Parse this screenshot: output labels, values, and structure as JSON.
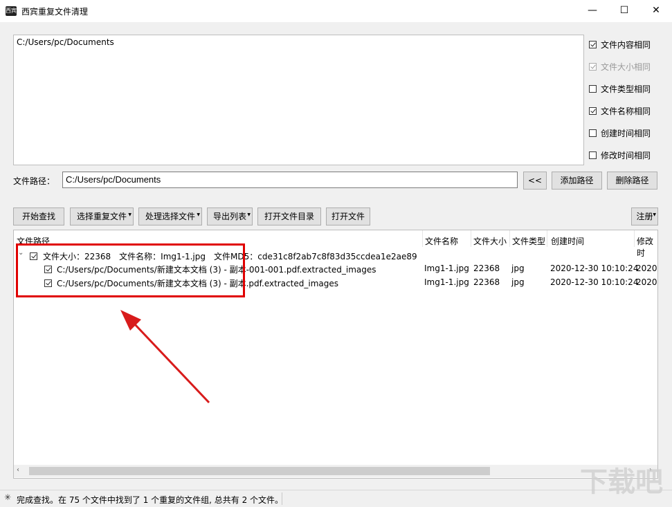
{
  "window": {
    "title": "西宾重复文件清理",
    "icon_text": "西宾",
    "controls": {
      "minimize": "—",
      "maximize": "☐",
      "close": "✕"
    }
  },
  "paths_list": [
    "C:/Users/pc/Documents"
  ],
  "options": [
    {
      "label": "文件内容相同",
      "checked": true,
      "disabled": false
    },
    {
      "label": "文件大小相同",
      "checked": true,
      "disabled": true
    },
    {
      "label": "文件类型相同",
      "checked": false,
      "disabled": false
    },
    {
      "label": "文件名称相同",
      "checked": true,
      "disabled": false
    },
    {
      "label": "创建时间相同",
      "checked": false,
      "disabled": false
    },
    {
      "label": "修改时间相同",
      "checked": false,
      "disabled": false
    }
  ],
  "path_row": {
    "label": "文件路径：",
    "value": "C:/Users/pc/Documents",
    "browse_label": "<<",
    "add_label": "添加路径",
    "remove_label": "删除路径"
  },
  "toolbar": {
    "start": "开始查找",
    "select_dup": "选择重复文件",
    "process": "处理选择文件",
    "export": "导出列表",
    "open_dir": "打开文件目录",
    "open_file": "打开文件",
    "register": "注册"
  },
  "results": {
    "headers": {
      "path": "文件路径",
      "name": "文件名称",
      "size": "文件大小",
      "type": "文件类型",
      "created": "创建时间",
      "modified": "修改时"
    },
    "group": {
      "label": "文件大小：22368　文件名称：Img1-1.jpg　文件MD5：cde31c8f2ab7c8f83d35ccdea1e2ae89",
      "checked": true
    },
    "rows": [
      {
        "path": "C:/Users/pc/Documents/新建文本文档 (3) - 副本-001-001.pdf.extracted_images",
        "name": "Img1-1.jpg",
        "size": "22368",
        "type": "jpg",
        "created": "2020-12-30 10:10:24",
        "modified": "2020-",
        "checked": true
      },
      {
        "path": "C:/Users/pc/Documents/新建文本文档 (3) - 副本.pdf.extracted_images",
        "name": "Img1-1.jpg",
        "size": "22368",
        "type": "jpg",
        "created": "2020-12-30 10:10:24",
        "modified": "2020-",
        "checked": true
      }
    ]
  },
  "status": {
    "text": "完成查找。在 75 个文件中找到了 1 个重复的文件组, 总共有 2 个文件。"
  },
  "watermark_text": "下载吧",
  "colors": {
    "highlight": "#e00000",
    "arrow": "#d81b1b"
  }
}
